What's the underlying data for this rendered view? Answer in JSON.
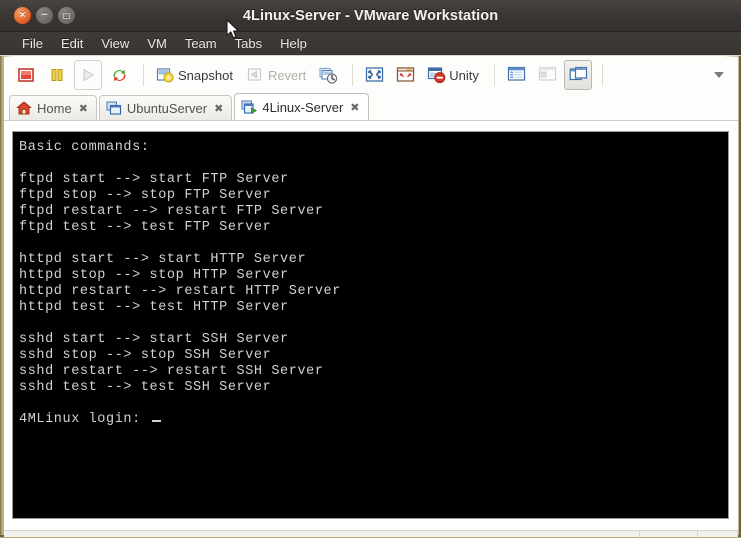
{
  "window": {
    "title": "4Linux-Server - VMware Workstation",
    "buttons": [
      {
        "name": "close",
        "glyph": "×"
      },
      {
        "name": "minimize",
        "glyph": "−"
      },
      {
        "name": "maximize",
        "glyph": "□"
      }
    ]
  },
  "menu": {
    "items": [
      {
        "label": "File"
      },
      {
        "label": "Edit"
      },
      {
        "label": "View"
      },
      {
        "label": "VM"
      },
      {
        "label": "Team"
      },
      {
        "label": "Tabs"
      },
      {
        "label": "Help"
      }
    ]
  },
  "toolbar": {
    "stop_icon": "stop-icon",
    "pause_icon": "pause-icon",
    "play_icon": "play-icon",
    "reset_icon": "reset-icon",
    "snapshot_label": "Snapshot",
    "snapshot_icon": "snapshot-icon",
    "revert_label": "Revert",
    "revert_icon": "revert-icon",
    "snapshot_manager_icon": "snapshot-manager-icon",
    "fullscreen_icon": "fullscreen-icon",
    "quickswitch_icon": "quick-switch-icon",
    "unity_label": "Unity",
    "unity_icon": "unity-icon",
    "sidebar_icon": "show-sidebar-icon",
    "thumbnail_icon": "thumbnail-bar-icon",
    "tabs_view_icon": "tabs-view-icon",
    "overflow_icon": "chevron-down-icon"
  },
  "tabs": [
    {
      "label": "Home",
      "icon": "home-icon",
      "close": "✖",
      "active": false
    },
    {
      "label": "UbuntuServer",
      "icon": "vm-icon",
      "close": "✖",
      "active": false
    },
    {
      "label": "4Linux-Server",
      "icon": "vm-running-icon",
      "close": "✖",
      "active": true
    }
  ],
  "terminal": {
    "foreground": "#d2d2d2",
    "background": "#000000",
    "lines": [
      "Basic commands:",
      "",
      "ftpd start --> start FTP Server",
      "ftpd stop --> stop FTP Server",
      "ftpd restart --> restart FTP Server",
      "ftpd test --> test FTP Server",
      "",
      "httpd start --> start HTTP Server",
      "httpd stop --> stop HTTP Server",
      "httpd restart --> restart HTTP Server",
      "httpd test --> test HTTP Server",
      "",
      "sshd start --> start SSH Server",
      "sshd stop --> stop SSH Server",
      "sshd restart --> restart SSH Server",
      "sshd test --> test SSH Server",
      "",
      "4MLinux login:"
    ],
    "prompt_cursor": "_"
  },
  "colors": {
    "titlebar": "#3c3734",
    "close_button": "#e2591d",
    "window_border": "#b9a878",
    "terminal_bg": "#000000",
    "terminal_fg": "#d2d2d2",
    "toolbar_bg": "#fdfdfb",
    "active_tab_bg": "#ffffff"
  }
}
